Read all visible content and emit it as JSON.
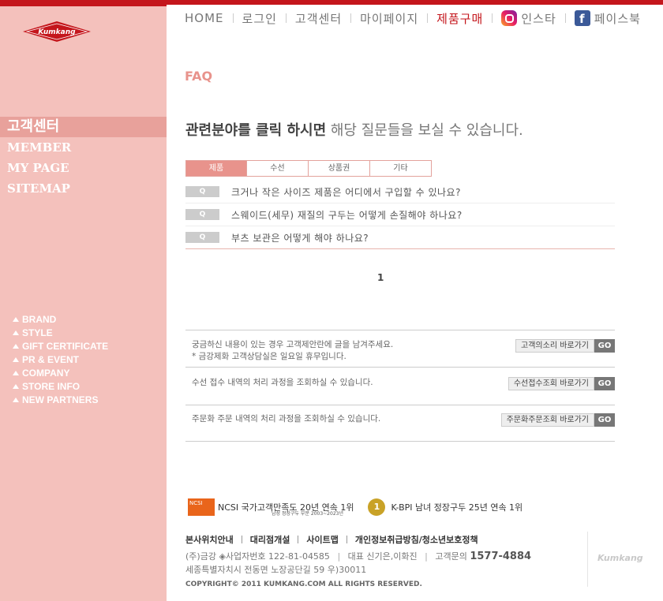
{
  "brand": {
    "logo_text": "Kumkang",
    "accent": "#c4161c",
    "sidebar_bg": "#f4c1bc"
  },
  "sidebar": {
    "main": [
      {
        "label": "고객센터",
        "active": true
      },
      {
        "label": "MEMBER"
      },
      {
        "label": "MY PAGE"
      },
      {
        "label": "SITEMAP"
      }
    ],
    "sub": [
      "BRAND",
      "STYLE",
      "GIFT CERTIFICATE",
      "PR & EVENT",
      "COMPANY",
      "STORE INFO",
      "NEW PARTNERS"
    ]
  },
  "nav": {
    "home": "HOME",
    "login": "로그인",
    "cs": "고객센터",
    "mypage": "마이페이지",
    "shop": "제품구매",
    "insta": "인스타",
    "facebook": "페이스북"
  },
  "faq": {
    "title": "FAQ",
    "headline_bold": "관련분야를 클릭 하시면",
    "headline_rest": " 해당 질문들을 보실 수 있습니다.",
    "tabs": [
      "제품",
      "수선",
      "상품권",
      "기타"
    ],
    "q_badge": "Q",
    "questions": [
      "크거나 작은 사이즈 제품은 어디에서 구입할 수 있나요?",
      "스웨이드(세무) 재질의 구두는 어떻게 손질해야 하나요?",
      "부츠 보관은 어떻게 해야 하나요?"
    ],
    "page": "1"
  },
  "contact": [
    {
      "line1": "궁금하신 내용이 있는 경우 고객제안란에 글을 남겨주세요.",
      "line2": "* 금강제화 고객상담실은 일요일 휴무입니다.",
      "button": "고객의소리 바로가기",
      "go": "GO"
    },
    {
      "line1": "수선 접수 내역의 처리 과정을 조회하실 수 있습니다.",
      "button": "수선접수조회 바로가기",
      "go": "GO"
    },
    {
      "line1": "주문화 주문 내역의 처리 과정을 조회하실 수 있습니다.",
      "button": "주문화주문조회 바로가기",
      "go": "GO"
    }
  ],
  "footer": {
    "award1_badge": "NCSI",
    "award1": "NCSI 국가고객만족도 20년 연속 1위",
    "award1_sub": "남성 정장구두 부문 2003~2023년",
    "award2_badge": "1",
    "award2": "K-BPI 남녀 정장구두 25년 연속 1위",
    "links": [
      "본사위치안내",
      "대리점개설",
      "사이트맵",
      "개인정보취급방침/청소년보호정책"
    ],
    "company": "(주)금강",
    "biz_no": "◈사업자번호 122-81-04585",
    "ceo": "대표 신기은,이화진",
    "phone_label": "고객문의",
    "phone": "1577-4884",
    "address": "세종특별자치시 전동면 노장공단길 59 우)30011",
    "copyright": "COPYRIGHT© 2011 KUMKANG.COM ALL RIGHTS RESERVED.",
    "logo": "Kumkang"
  }
}
